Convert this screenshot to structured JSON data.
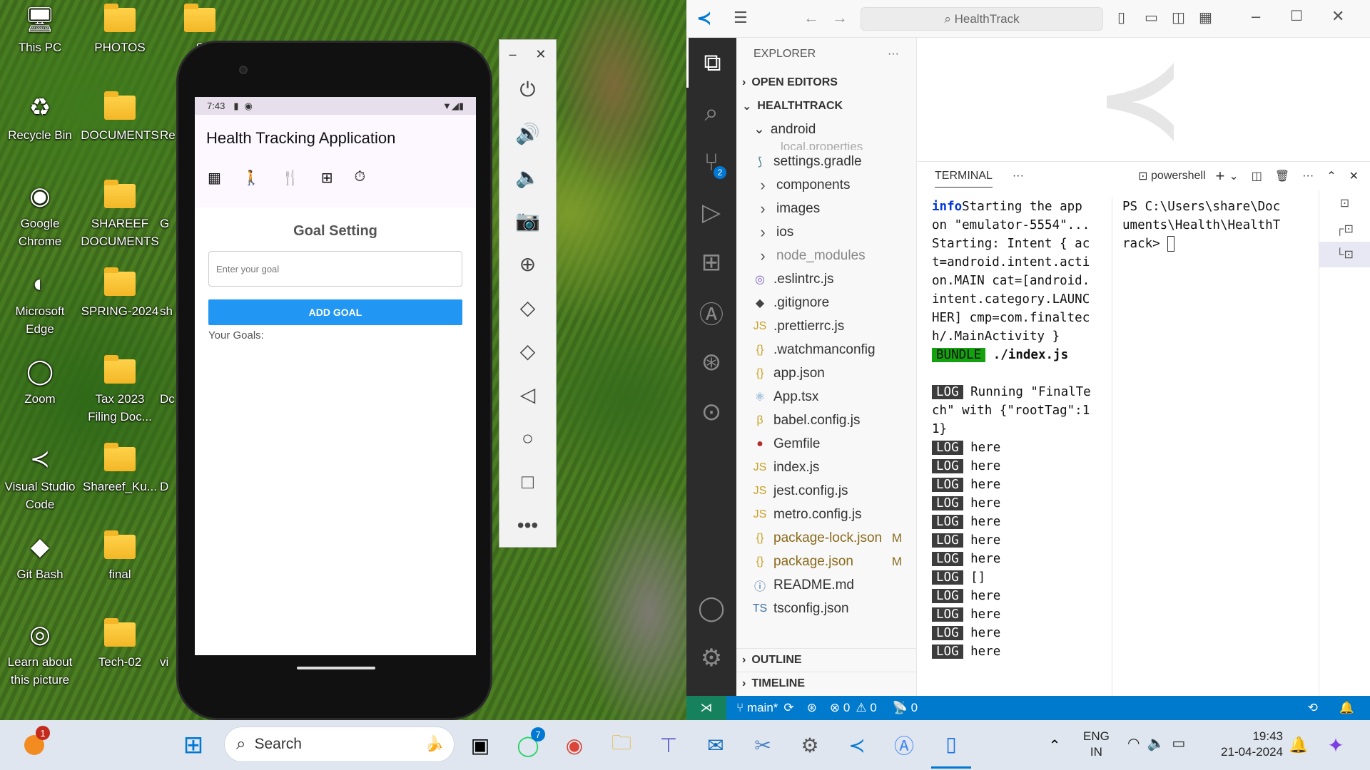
{
  "desktop": {
    "icons": [
      {
        "label": "This PC",
        "kind": "pc"
      },
      {
        "label": "PHOTOS",
        "kind": "folder"
      },
      {
        "label": "S",
        "kind": "folder"
      },
      {
        "label": "Recycle Bin",
        "kind": "bin"
      },
      {
        "label": "DOCUMENTS",
        "kind": "folder"
      },
      {
        "label": "Re",
        "kind": "text"
      },
      {
        "label": "Google Chrome",
        "kind": "chrome"
      },
      {
        "label": "SHAREEF DOCUMENTS",
        "kind": "folder"
      },
      {
        "label": "G",
        "kind": "text"
      },
      {
        "label": "Microsoft Edge",
        "kind": "edge"
      },
      {
        "label": "SPRING-2024",
        "kind": "folder"
      },
      {
        "label": "sh",
        "kind": "text"
      },
      {
        "label": "Zoom",
        "kind": "zoom"
      },
      {
        "label": "Tax 2023 Filing Doc...",
        "kind": "folder"
      },
      {
        "label": "Dc",
        "kind": "text"
      },
      {
        "label": "Visual Studio Code",
        "kind": "vscode"
      },
      {
        "label": "Shareef_Ku...",
        "kind": "folder"
      },
      {
        "label": "D",
        "kind": "text"
      },
      {
        "label": "Git Bash",
        "kind": "git"
      },
      {
        "label": "final",
        "kind": "folder"
      },
      {
        "label": "Learn about this picture",
        "kind": "camera"
      },
      {
        "label": "Tech-02",
        "kind": "folder"
      },
      {
        "label": "vi",
        "kind": "text"
      }
    ]
  },
  "phone": {
    "time": "7:43",
    "app_title": "Health Tracking Application",
    "nav_icons": [
      "dashboard-icon",
      "walk-icon",
      "food-icon",
      "medical-icon",
      "timer-icon"
    ],
    "goal_heading": "Goal Setting",
    "goal_placeholder": "Enter your goal",
    "add_goal_label": "ADD GOAL",
    "goals_label": "Your Goals:"
  },
  "emulator_controls": [
    "power",
    "volume-up",
    "volume-down",
    "camera",
    "zoom",
    "rotate-left",
    "rotate-right",
    "back",
    "home",
    "overview",
    "more"
  ],
  "vscode": {
    "search": "HealthTrack",
    "explorer_title": "EXPLORER",
    "open_editors": "OPEN EDITORS",
    "project": "HEALTHTRACK",
    "source_control_badge": "2",
    "folder_open": "android",
    "partial_item": "local.properties",
    "files": [
      {
        "name": "settings.gradle",
        "icon": "gradle-icon",
        "glyph": "⟆",
        "color": "#3c7c8c",
        "status": ""
      },
      {
        "name": "components",
        "icon": "chevron-right-icon",
        "glyph": "›",
        "color": "#555",
        "status": ""
      },
      {
        "name": "images",
        "icon": "chevron-right-icon",
        "glyph": "›",
        "color": "#555",
        "status": ""
      },
      {
        "name": "ios",
        "icon": "chevron-right-icon",
        "glyph": "›",
        "color": "#555",
        "status": ""
      },
      {
        "name": "node_modules",
        "icon": "chevron-right-icon",
        "glyph": "›",
        "color": "#555",
        "status": ""
      },
      {
        "name": ".eslintrc.js",
        "icon": "eslint-icon",
        "glyph": "◎",
        "color": "#7b5cbd",
        "status": ""
      },
      {
        "name": ".gitignore",
        "icon": "git-icon",
        "glyph": "◆",
        "color": "#444",
        "status": ""
      },
      {
        "name": ".prettierrc.js",
        "icon": "js-icon",
        "glyph": "JS",
        "color": "#c9a227",
        "status": ""
      },
      {
        "name": ".watchmanconfig",
        "icon": "json-icon",
        "glyph": "{}",
        "color": "#c9a227",
        "status": ""
      },
      {
        "name": "app.json",
        "icon": "json-icon",
        "glyph": "{}",
        "color": "#c9a227",
        "status": ""
      },
      {
        "name": "App.tsx",
        "icon": "react-icon",
        "glyph": "⚛",
        "color": "#4a8ab8",
        "status": ""
      },
      {
        "name": "babel.config.js",
        "icon": "babel-icon",
        "glyph": "β",
        "color": "#c9a227",
        "status": ""
      },
      {
        "name": "Gemfile",
        "icon": "ruby-icon",
        "glyph": "●",
        "color": "#b03030",
        "status": ""
      },
      {
        "name": "index.js",
        "icon": "js-icon",
        "glyph": "JS",
        "color": "#c9a227",
        "status": ""
      },
      {
        "name": "jest.config.js",
        "icon": "js-icon",
        "glyph": "JS",
        "color": "#c9a227",
        "status": ""
      },
      {
        "name": "metro.config.js",
        "icon": "js-icon",
        "glyph": "JS",
        "color": "#c9a227",
        "status": ""
      },
      {
        "name": "package-lock.json",
        "icon": "json-icon",
        "glyph": "{}",
        "color": "#c9a227",
        "status": "M"
      },
      {
        "name": "package.json",
        "icon": "json-icon",
        "glyph": "{}",
        "color": "#c9a227",
        "status": "M"
      },
      {
        "name": "README.md",
        "icon": "info-icon",
        "glyph": "ⓘ",
        "color": "#3a6ea5",
        "status": ""
      },
      {
        "name": "tsconfig.json",
        "icon": "ts-icon",
        "glyph": "TS",
        "color": "#3a6ea5",
        "status": ""
      }
    ],
    "outline": "OUTLINE",
    "timeline": "TIMELINE",
    "panel_tab": "TERMINAL",
    "shell": "powershell",
    "terminal_lines": [
      {
        "tag": "info",
        "text": "Starting the app on \"emulator-5554\"..."
      },
      {
        "tag": "",
        "text": "Starting: Intent { act=android.intent.action.MAIN cat=[android.intent.category.LAUNCHER] cmp=com.finaltech/.MainActivity }"
      },
      {
        "tag": "BUNDLE",
        "text": " ./index.js"
      },
      {
        "tag": "",
        "text": " "
      },
      {
        "tag": "LOG",
        "text": " Running \"FinalTech\" with {\"rootTag\":11}"
      },
      {
        "tag": "LOG",
        "text": " here"
      },
      {
        "tag": "LOG",
        "text": " here"
      },
      {
        "tag": "LOG",
        "text": " here"
      },
      {
        "tag": "LOG",
        "text": " here"
      },
      {
        "tag": "LOG",
        "text": " here"
      },
      {
        "tag": "LOG",
        "text": " here"
      },
      {
        "tag": "LOG",
        "text": " here"
      },
      {
        "tag": "LOG",
        "text": " []"
      },
      {
        "tag": "LOG",
        "text": " here"
      },
      {
        "tag": "LOG",
        "text": " here"
      },
      {
        "tag": "LOG",
        "text": " here"
      },
      {
        "tag": "LOG",
        "text": " here"
      }
    ],
    "prompt": "PS C:\\Users\\share\\Documents\\Health\\HealthTrack> ",
    "status": {
      "branch": "main*",
      "errors": "0",
      "warnings": "0",
      "ports": "0"
    }
  },
  "taskbar": {
    "search": "Search",
    "notif_badge": "1",
    "whatsapp_badge": "7",
    "lang1": "ENG",
    "lang2": "IN",
    "time": "19:43",
    "date": "21-04-2024"
  }
}
